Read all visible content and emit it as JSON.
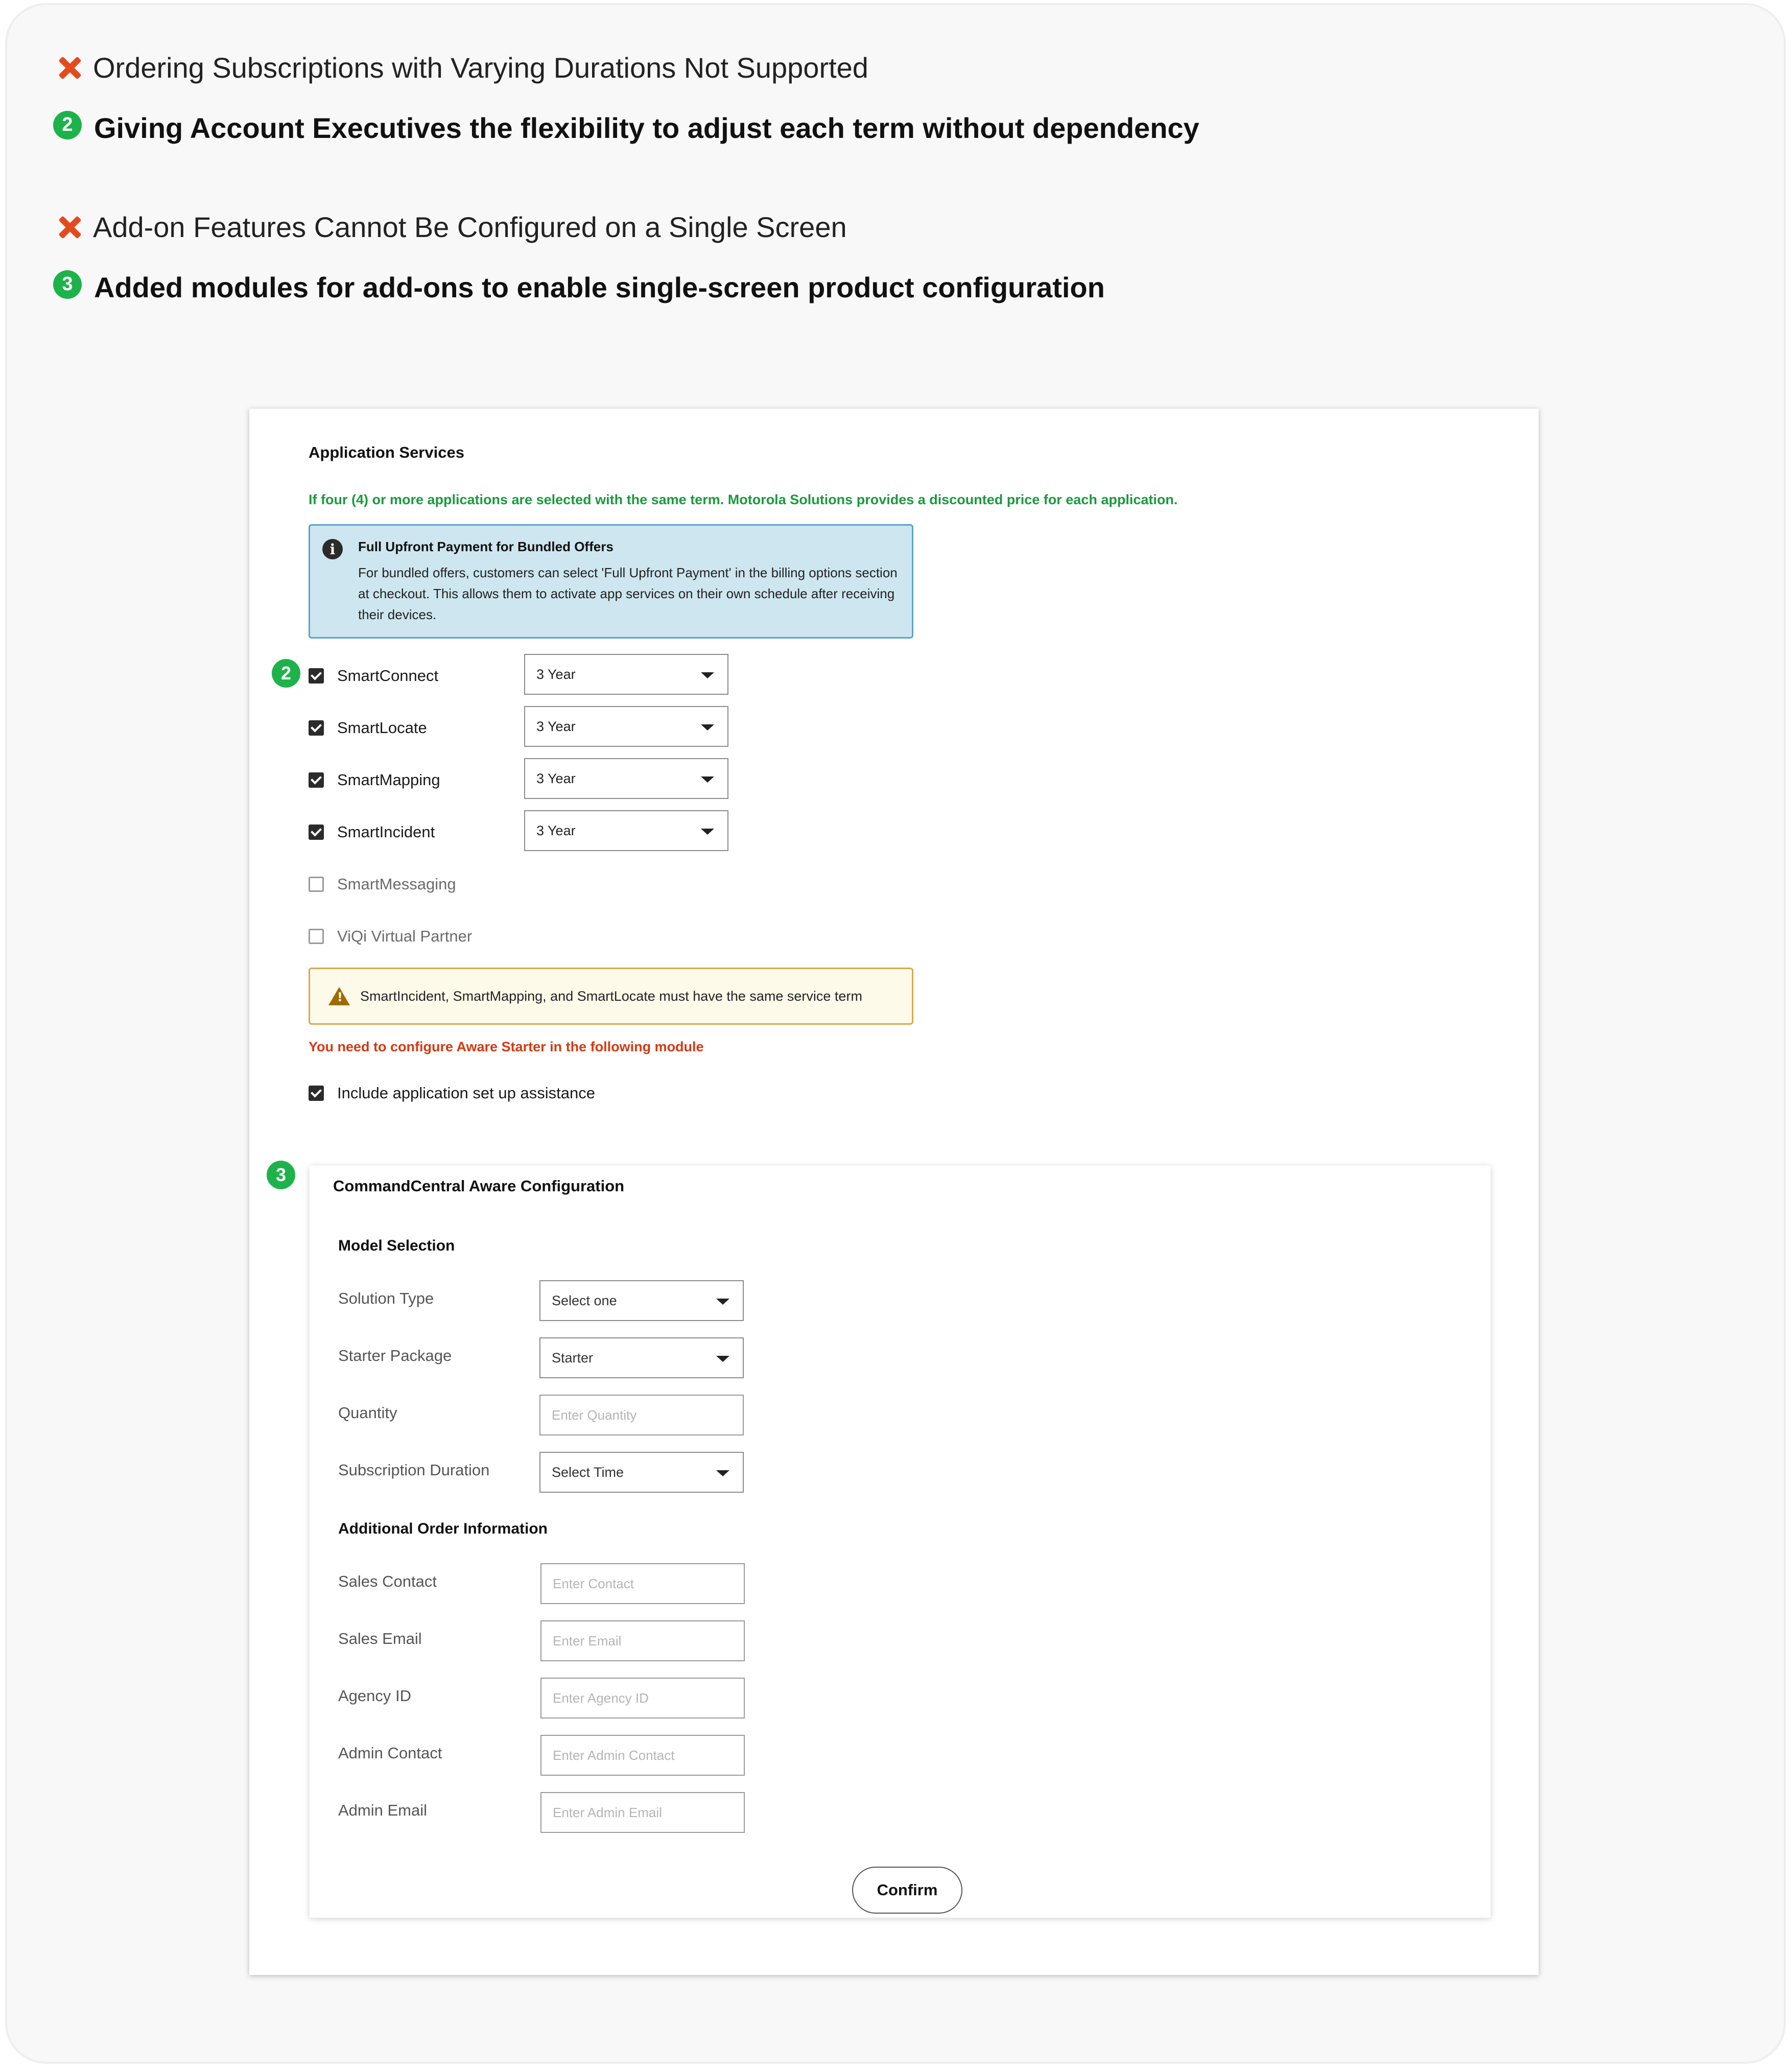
{
  "notes": [
    {
      "type": "problem",
      "text": "Ordering Subscriptions with Varying Durations Not Supported"
    },
    {
      "type": "solution",
      "badge": "2",
      "text": "Giving Account Executives the flexibility to adjust each term without dependency"
    },
    {
      "type": "problem",
      "text": "Add-on Features Cannot Be Configured on a Single Screen"
    },
    {
      "type": "solution",
      "badge": "3",
      "text": "Added modules for add-ons to enable single-screen product configuration"
    }
  ],
  "app_services": {
    "title": "Application Services",
    "discount_note": "If four (4) or more applications are selected with the same term. Motorola Solutions provides a discounted price for each application.",
    "info": {
      "icon": "info-icon",
      "title": "Full Upfront Payment for Bundled Offers",
      "body": "For bundled offers, customers can select 'Full Upfront Payment' in the billing options section at checkout. This allows them to activate app services on their own schedule after receiving their devices."
    },
    "marker_badge": "2",
    "apps": [
      {
        "label": "SmartConnect",
        "checked": true,
        "term": "3 Year"
      },
      {
        "label": "SmartLocate",
        "checked": true,
        "term": "3 Year"
      },
      {
        "label": "SmartMapping",
        "checked": true,
        "term": "3 Year"
      },
      {
        "label": "SmartIncident",
        "checked": true,
        "term": "3 Year"
      },
      {
        "label": "SmartMessaging",
        "checked": false
      },
      {
        "label": "ViQi Virtual Partner",
        "checked": false
      }
    ],
    "warning": "SmartIncident, SmartMapping, and SmartLocate must have the same service term",
    "error_note": "You need to configure Aware Starter in the following module",
    "setup_assistance": {
      "label": "Include application set up assistance",
      "checked": true
    }
  },
  "aware_config": {
    "marker_badge": "3",
    "title": "CommandCentral Aware Configuration",
    "model_selection": {
      "heading": "Model Selection",
      "fields": [
        {
          "label": "Solution Type",
          "kind": "select",
          "value": "Select one"
        },
        {
          "label": "Starter Package",
          "kind": "select",
          "value": "Starter"
        },
        {
          "label": "Quantity",
          "kind": "input",
          "placeholder": "Enter Quantity"
        },
        {
          "label": "Subscription Duration",
          "kind": "select",
          "value": "Select Time"
        }
      ]
    },
    "additional_info": {
      "heading": "Additional Order Information",
      "fields": [
        {
          "label": "Sales Contact",
          "placeholder": "Enter Contact"
        },
        {
          "label": "Sales Email",
          "placeholder": "Enter Email"
        },
        {
          "label": "Agency ID",
          "placeholder": "Enter Agency ID"
        },
        {
          "label": "Admin Contact",
          "placeholder": "Enter Admin Contact"
        },
        {
          "label": "Admin Email",
          "placeholder": "Enter Admin Email"
        }
      ]
    },
    "confirm_label": "Confirm"
  },
  "colors": {
    "problem_icon": "#e34b1f",
    "solution_badge": "#1db34a",
    "discount_note": "#1a9a3c",
    "error_note": "#d43a12",
    "info_bg": "#cde6ef",
    "warning_bg": "#fefaea"
  }
}
